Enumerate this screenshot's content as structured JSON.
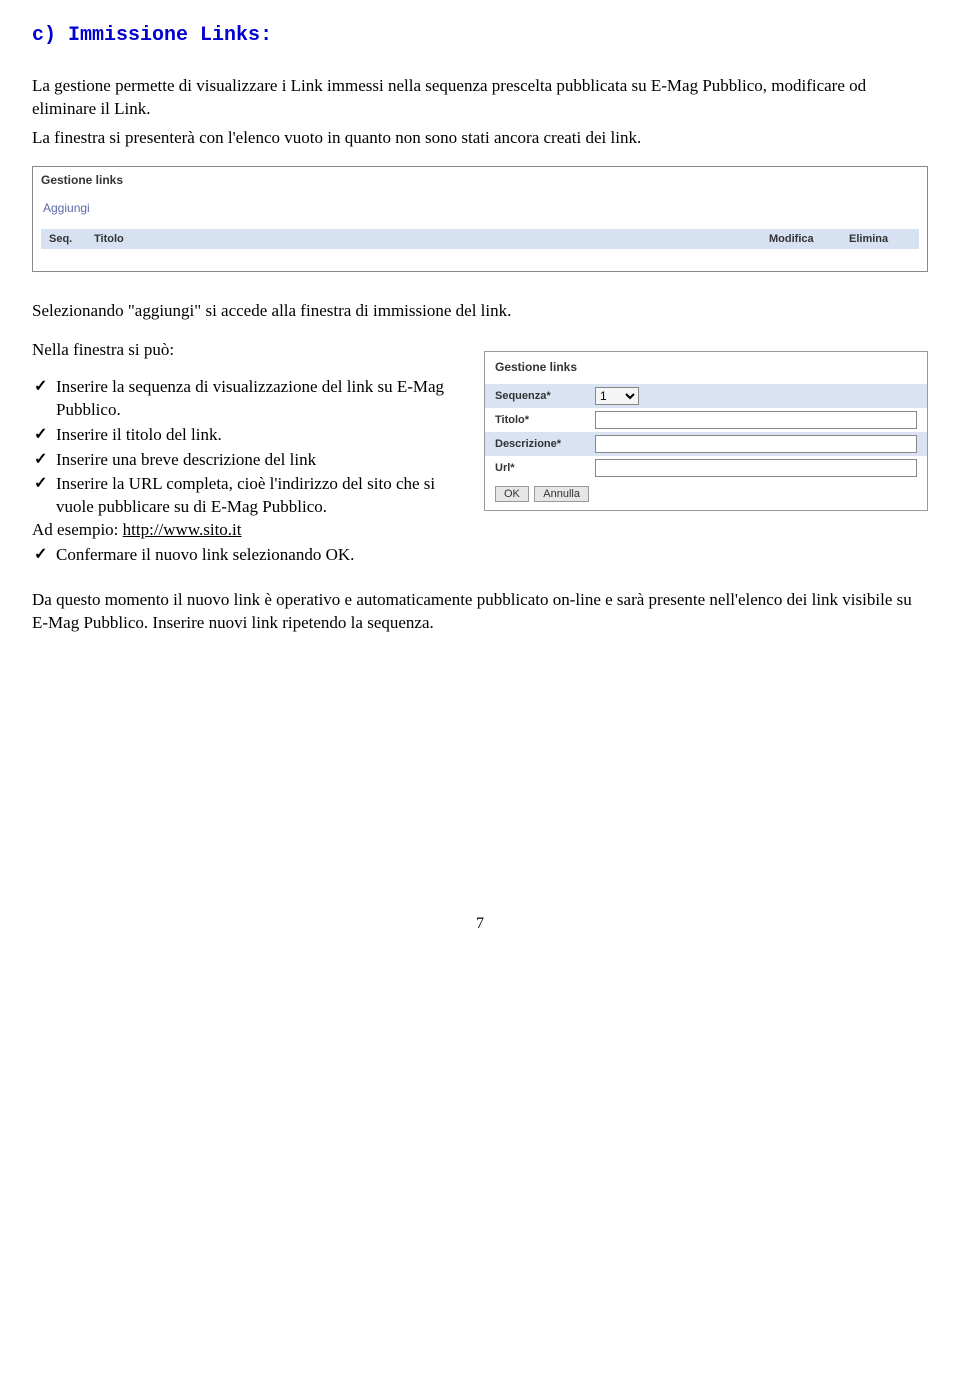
{
  "heading_prefix": "c)",
  "heading_label": "Immissione Links:",
  "intro_p1": "La gestione permette di visualizzare i Link immessi nella sequenza prescelta pubblicata su E-Mag Pubblico, modificare od eliminare il Link.",
  "intro_p2": "La finestra si presenterà con l'elenco vuoto in quanto non sono stati ancora creati dei link.",
  "shot1": {
    "title": "Gestione links",
    "aggiungi": "Aggiungi",
    "headers": {
      "seq": "Seq.",
      "titolo": "Titolo",
      "modifica": "Modifica",
      "elimina": "Elimina"
    }
  },
  "p_selezionando": "Selezionando  \"aggiungi\" si accede alla finestra di immissione del link.",
  "p_nella": "Nella finestra si può:",
  "bullets": {
    "b1a": "Inserire la sequenza di visualizzazione del link su E-Mag Pubblico.",
    "b2": "Inserire il titolo del link.",
    "b3": "Inserire una breve descrizione del link",
    "b4a": "Inserire la URL completa, cioè l'indirizzo del sito che si vuole pubblicare su di E-Mag Pubblico.",
    "b4b_pre": "Ad esempio: ",
    "b4b_link": "http://www.sito.it",
    "b5": "Confermare il nuovo link selezionando OK."
  },
  "form": {
    "panel_title": "Gestione links",
    "sequenza": "Sequenza*",
    "sequenza_value": "1",
    "titolo": "Titolo*",
    "descrizione": "Descrizione*",
    "url": "Url*",
    "ok": "OK",
    "annulla": "Annulla"
  },
  "p_final": "Da questo momento il nuovo link  è operativo e automaticamente pubblicato on-line e sarà presente nell'elenco dei link visibile su E-Mag Pubblico. Inserire nuovi link ripetendo la sequenza.",
  "page_number": "7"
}
